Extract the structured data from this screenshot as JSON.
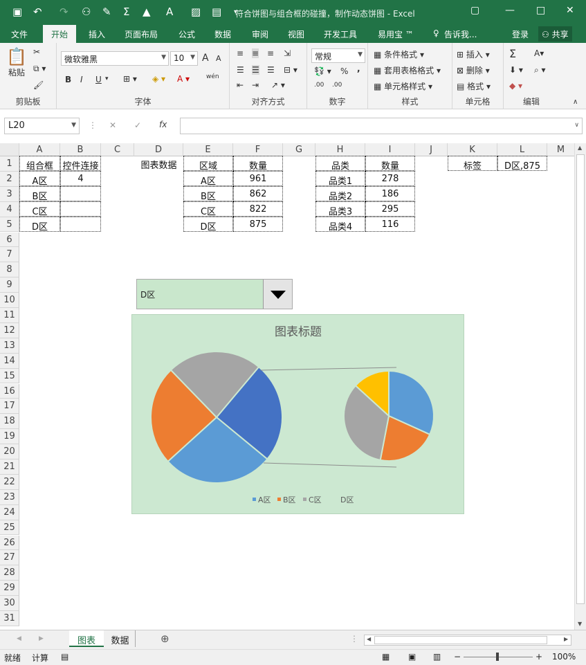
{
  "titlebar": {
    "title": "符合饼图与组合框的碰撞，制作动态饼图 - Excel",
    "qa_icons": [
      "save-icon",
      "undo-icon",
      "redo-icon",
      "user-icon",
      "brush-icon",
      "sum-icon",
      "fill-icon",
      "font-color-icon",
      "picture-icon",
      "chart-icon",
      "customize-icon"
    ],
    "window_icons": [
      "ribbon-display-icon",
      "minimize-icon",
      "maximize-icon",
      "close-icon"
    ]
  },
  "ribbon_tabs": [
    "文件",
    "开始",
    "插入",
    "页面布局",
    "公式",
    "数据",
    "审阅",
    "视图",
    "开发工具",
    "易用宝 ™",
    "告诉我...",
    "登录",
    "共享"
  ],
  "ribbon": {
    "clipboard": {
      "paste": "粘贴",
      "label": "剪贴板"
    },
    "font": {
      "name": "微软雅黑",
      "size": "10",
      "bold": "B",
      "italic": "I",
      "underline": "U",
      "grow": "A",
      "shrink": "A",
      "label": "字体",
      "phonetic": "wén"
    },
    "align": {
      "label": "对齐方式"
    },
    "number": {
      "format": "常规",
      "percent": "%",
      "comma": ",",
      "label": "数字",
      "dec_more": ".00",
      "dec_less": ".00"
    },
    "styles": {
      "cond": "条件格式",
      "table": "套用表格格式",
      "cell": "单元格样式",
      "label": "样式"
    },
    "cells": {
      "insert": "插入",
      "delete": "删除",
      "format": "格式",
      "label": "单元格"
    },
    "editing": {
      "label": "编辑",
      "sum": "Σ"
    }
  },
  "formula_bar": {
    "name_box": "L20",
    "cancel": "✕",
    "enter": "✓",
    "fx": "fx",
    "value": ""
  },
  "columns": [
    "A",
    "B",
    "C",
    "D",
    "E",
    "F",
    "G",
    "H",
    "I",
    "J",
    "K",
    "L",
    "M"
  ],
  "rows": [
    "1",
    "2",
    "3",
    "4",
    "5",
    "6",
    "7",
    "8",
    "9",
    "10",
    "11",
    "12",
    "13",
    "14",
    "15",
    "16",
    "17",
    "18",
    "19",
    "20",
    "21",
    "22",
    "23",
    "24",
    "25",
    "26",
    "27",
    "28",
    "29",
    "30",
    "31"
  ],
  "cells": {
    "A1": "组合框",
    "B1": "控件连接",
    "A2": "A区",
    "B2": "4",
    "A3": "B区",
    "A4": "C区",
    "A5": "D区",
    "D1": "图表数据",
    "E1": "区域",
    "F1": "数量",
    "E2": "A区",
    "F2": "961",
    "E3": "B区",
    "F3": "862",
    "E4": "C区",
    "F4": "822",
    "E5": "D区",
    "F5": "875",
    "H1": "品类",
    "I1": "数量",
    "H2": "品类1",
    "I2": "278",
    "H3": "品类2",
    "I3": "186",
    "H4": "品类3",
    "I4": "295",
    "H5": "品类4",
    "I5": "116",
    "K1": "标签",
    "L1": "D区,875"
  },
  "dropdown": {
    "value": "D区"
  },
  "chart_data": {
    "type": "pie",
    "subtype": "pie-of-pie",
    "title": "图表标题",
    "main_pie": {
      "categories": [
        "A区",
        "B区",
        "C区",
        "D区"
      ],
      "values": [
        961,
        862,
        822,
        875
      ],
      "colors": [
        "#5b9bd5",
        "#ed7d31",
        "#a5a5a5",
        "#4472c4"
      ]
    },
    "secondary_pie": {
      "categories": [
        "品类1",
        "品类2",
        "品类3",
        "品类4"
      ],
      "values": [
        278,
        186,
        295,
        116
      ],
      "colors": [
        "#5b9bd5",
        "#ed7d31",
        "#a5a5a5",
        "#ffc000"
      ]
    },
    "legend": [
      "A区",
      "B区",
      "C区",
      "D区"
    ],
    "legend_position": "bottom",
    "background": "#cce8d1"
  },
  "sheet_tabs": [
    "图表",
    "数据"
  ],
  "status": {
    "ready": "就绪",
    "calc": "计算",
    "zoom": "100%"
  }
}
